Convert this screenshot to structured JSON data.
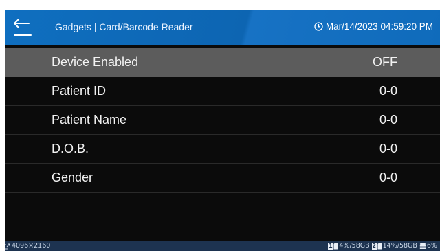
{
  "header": {
    "title": "Gadgets | Card/Barcode Reader",
    "clock": "Mar/14/2023 04:59:20 PM",
    "back_icon": "back-arrow-icon",
    "clock_icon": "clock-icon",
    "accent_color": "#0f6fc0"
  },
  "rows": [
    {
      "label": "Device Enabled",
      "value": "OFF"
    },
    {
      "label": "Patient ID",
      "value": "0-0"
    },
    {
      "label": "Patient Name",
      "value": "0-0"
    },
    {
      "label": "D.O.B.",
      "value": "0-0"
    },
    {
      "label": "Gender",
      "value": "0-0"
    }
  ],
  "statusbar": {
    "resolution": "4096×2160",
    "slot1_num": "1",
    "slot1_usage": "4%/58GB",
    "slot2_num": "2",
    "slot2_usage": "14%/58GB",
    "storage": "6%",
    "background_color": "#1d3350"
  }
}
